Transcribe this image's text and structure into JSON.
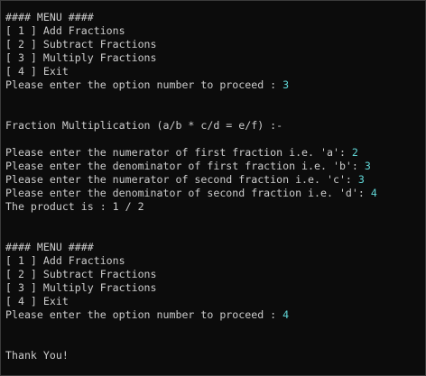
{
  "console": {
    "menu_title": "#### MENU ####",
    "menu_items": [
      "[ 1 ] Add Fractions",
      "[ 2 ] Subtract Fractions",
      "[ 3 ] Multiply Fractions",
      "[ 4 ] Exit"
    ],
    "prompt_option": "Please enter the option number to proceed : ",
    "first_choice": "3",
    "mult_header": "Fraction Multiplication (a/b * c/d = e/f) :-",
    "prompt_a": "Please enter the numerator of first fraction i.e. 'a': ",
    "value_a": "2",
    "prompt_b": "Please enter the denominator of first fraction i.e. 'b': ",
    "value_b": "3",
    "prompt_c": "Please enter the numerator of second fraction i.e. 'c': ",
    "value_c": "3",
    "prompt_d": "Please enter the denominator of second fraction i.e. 'd': ",
    "value_d": "4",
    "product_line": "The product is : 1 / 2",
    "second_choice": "4",
    "goodbye": "Thank You!",
    "input_color": "#61d6d6",
    "text_color": "#cccccc",
    "background_color": "#0c0c0c"
  }
}
